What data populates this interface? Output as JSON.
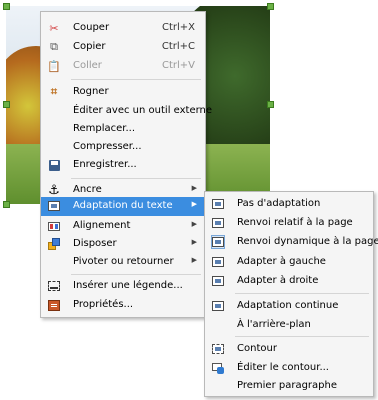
{
  "context_menu": {
    "items": [
      {
        "label": "Couper",
        "shortcut": "Ctrl+X",
        "icon": "scissors-icon"
      },
      {
        "label": "Copier",
        "shortcut": "Ctrl+C",
        "icon": "copy-icon"
      },
      {
        "label": "Coller",
        "shortcut": "Ctrl+V",
        "icon": "paste-icon",
        "disabled": true
      },
      {
        "label": "Rogner",
        "icon": "crop-icon"
      },
      {
        "label": "Éditer avec un outil externe"
      },
      {
        "label": "Remplacer..."
      },
      {
        "label": "Compresser..."
      },
      {
        "label": "Enregistrer...",
        "icon": "save-icon"
      },
      {
        "label": "Ancre",
        "icon": "anchor-icon",
        "submenu": true
      },
      {
        "label": "Adaptation du texte",
        "icon": "wrap-icon",
        "submenu": true,
        "highlighted": true
      },
      {
        "label": "Alignement",
        "icon": "align-icon",
        "submenu": true
      },
      {
        "label": "Disposer",
        "icon": "arrange-icon",
        "submenu": true
      },
      {
        "label": "Pivoter ou retourner",
        "submenu": true
      },
      {
        "label": "Insérer une légende...",
        "icon": "caption-icon"
      },
      {
        "label": "Propriétés...",
        "icon": "properties-icon"
      }
    ]
  },
  "wrap_submenu": {
    "items": [
      {
        "label": "Pas d'adaptation",
        "icon": "wrap-none-icon"
      },
      {
        "label": "Renvoi relatif à la page",
        "icon": "wrap-parallel-icon"
      },
      {
        "label": "Renvoi dynamique à la page",
        "icon": "wrap-optimal-icon"
      },
      {
        "label": "Adapter à gauche",
        "icon": "wrap-left-icon"
      },
      {
        "label": "Adapter à droite",
        "icon": "wrap-right-icon"
      },
      {
        "label": "Adaptation continue",
        "icon": "wrap-through-icon"
      },
      {
        "label": "À l'arrière-plan"
      },
      {
        "label": "Contour",
        "icon": "contour-icon"
      },
      {
        "label": "Éditer le contour...",
        "icon": "edit-contour-icon"
      },
      {
        "label": "Premier paragraphe"
      }
    ]
  },
  "colors": {
    "highlight": "#3b8de0",
    "menu_bg": "#f5f5f5"
  }
}
